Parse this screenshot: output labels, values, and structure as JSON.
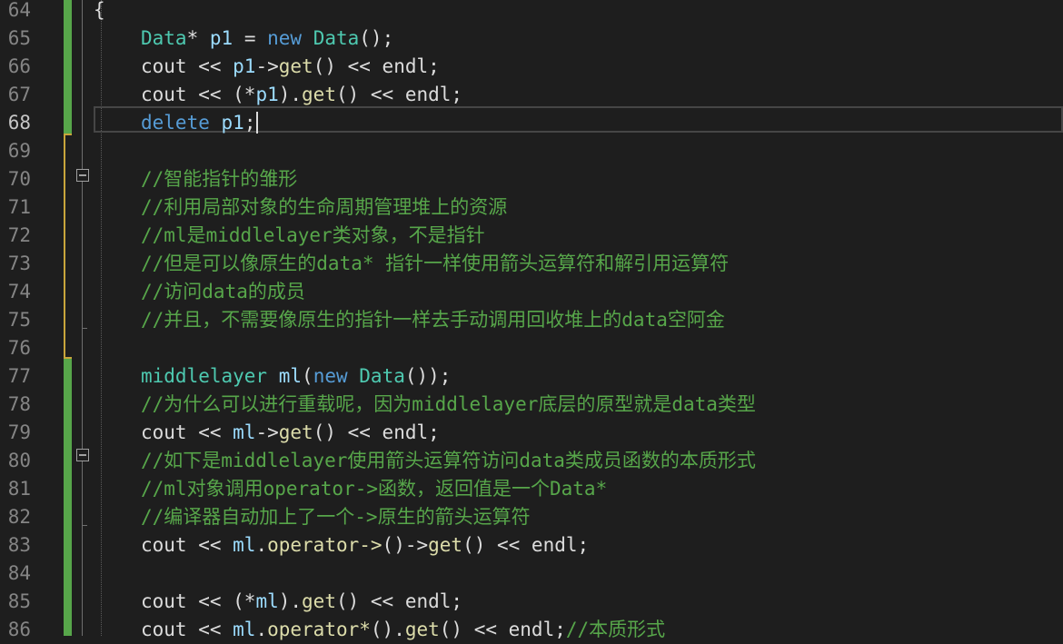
{
  "editor": {
    "line_numbers": [
      "64",
      "65",
      "66",
      "67",
      "68",
      "69",
      "70",
      "71",
      "72",
      "73",
      "74",
      "75",
      "76",
      "77",
      "78",
      "79",
      "80",
      "81",
      "82",
      "83",
      "84",
      "85",
      "86"
    ],
    "active_line": "68",
    "lines": {
      "l64": {
        "brace": "{"
      },
      "l65": {
        "t1": "Data",
        "p1": "* ",
        "v1": "p1",
        "p2": " = ",
        "k1": "new",
        "p3": " ",
        "t2": "Data",
        "p4": "();"
      },
      "l66": {
        "p1": "cout << ",
        "v1": "p1",
        "p2": "->",
        "f1": "get",
        "p3": "() << endl;"
      },
      "l67": {
        "p1": "cout << (*",
        "v1": "p1",
        "p2": ").",
        "f1": "get",
        "p3": "() << endl;"
      },
      "l68": {
        "k1": "delete",
        "p1": " ",
        "v1": "p1",
        "p2": ";"
      },
      "l70": {
        "c": "//智能指针的雏形"
      },
      "l71": {
        "c": "//利用局部对象的生命周期管理堆上的资源"
      },
      "l72": {
        "c": "//ml是middlelayer类对象，不是指针"
      },
      "l73": {
        "c": "//但是可以像原生的data* 指针一样使用箭头运算符和解引用运算符"
      },
      "l74": {
        "c": "//访问data的成员"
      },
      "l75": {
        "c": "//并且，不需要像原生的指针一样去手动调用回收堆上的data空阿金"
      },
      "l77": {
        "t1": "middlelayer",
        "p1": " ",
        "v1": "ml",
        "p2": "(",
        "k1": "new",
        "p3": " ",
        "t2": "Data",
        "p4": "());"
      },
      "l78": {
        "c": "//为什么可以进行重载呢，因为middlelayer底层的原型就是data类型"
      },
      "l79": {
        "p1": "cout << ",
        "v1": "ml",
        "p2": "->",
        "f1": "get",
        "p3": "() << endl;"
      },
      "l80": {
        "c": "//如下是middlelayer使用箭头运算符访问data类成员函数的本质形式"
      },
      "l81": {
        "c": "//ml对象调用operator->函数，返回值是一个Data*"
      },
      "l82": {
        "c": "//编译器自动加上了一个->原生的箭头运算符"
      },
      "l83": {
        "p1": "cout << ",
        "v1": "ml",
        "p2": ".",
        "f1": "operator->",
        "p3": "()->",
        "f2": "get",
        "p4": "() << endl;"
      },
      "l85": {
        "p1": "cout << (*",
        "v1": "ml",
        "p2": ").",
        "f1": "get",
        "p3": "() << endl;"
      },
      "l86": {
        "p1": "cout << ",
        "v1": "ml",
        "p2": ".",
        "f1": "operator*",
        "p3": "().",
        "f2": "get",
        "p4": "() << endl;",
        "c": "//本质形式"
      }
    }
  },
  "icons": {
    "fold_toggle": "collapse-minus-icon"
  },
  "colors": {
    "background": "#1e1e1e",
    "keyword": "#569cd6",
    "type": "#4ec9b0",
    "variable": "#9cdcfe",
    "function": "#dcdcaa",
    "comment": "#57a64a",
    "line_number": "#858585",
    "saved_change": "#57a64a",
    "unsaved_change": "#c8a53b"
  }
}
